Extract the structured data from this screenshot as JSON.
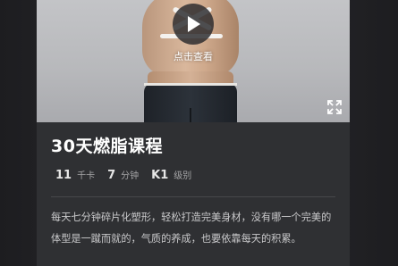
{
  "video": {
    "play_caption": "点击查看"
  },
  "course": {
    "title": "30天燃脂课程",
    "stats": [
      {
        "value": "11",
        "unit": "千卡"
      },
      {
        "value": "7",
        "unit": "分钟"
      },
      {
        "value": "K1",
        "unit": "级别"
      }
    ],
    "description": "每天七分钟碎片化塑形，轻松打造完美身材，没有哪一个完美的体型是一蹴而就的，气质的养成，也要依靠每天的积累。"
  },
  "colors": {
    "background": "#2a2a2d",
    "card": "#2f3033",
    "title": "#ffffff",
    "text": "#c9c9cb",
    "muted": "#a6a6a8"
  },
  "icons": {
    "play": "play-icon",
    "fullscreen": "fullscreen-icon"
  }
}
